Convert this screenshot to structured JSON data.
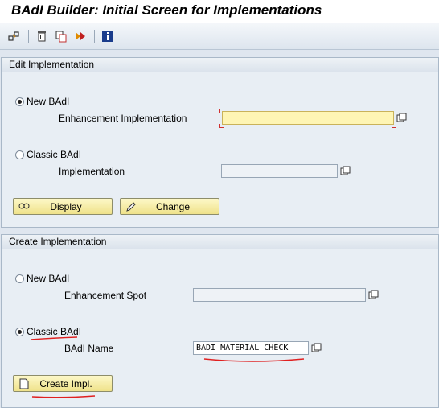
{
  "window": {
    "title": "BAdI Builder: Initial Screen for Implementations"
  },
  "toolbar": {
    "icons": [
      "other-object-icon",
      "delete-icon",
      "copy-icon",
      "rename-icon",
      "info-icon"
    ]
  },
  "edit": {
    "header": "Edit Implementation",
    "new_badi_label": "New BAdI",
    "enh_impl_label": "Enhancement Implementation",
    "enh_impl_value": "",
    "classic_badi_label": "Classic BAdI",
    "impl_label": "Implementation",
    "impl_value": "",
    "display_label": "Display",
    "change_label": "Change",
    "selected": "new"
  },
  "create": {
    "header": "Create Implementation",
    "new_badi_label": "New BAdI",
    "enh_spot_label": "Enhancement Spot",
    "enh_spot_value": "",
    "classic_badi_label": "Classic BAdI",
    "badi_name_label": "BAdI Name",
    "badi_name_value": "BADI_MATERIAL_CHECK",
    "create_label": "Create Impl.",
    "selected": "classic"
  },
  "colors": {
    "button_fill": "#efe28a",
    "required_field": "#fef5b4",
    "annotation": "#e02020"
  }
}
